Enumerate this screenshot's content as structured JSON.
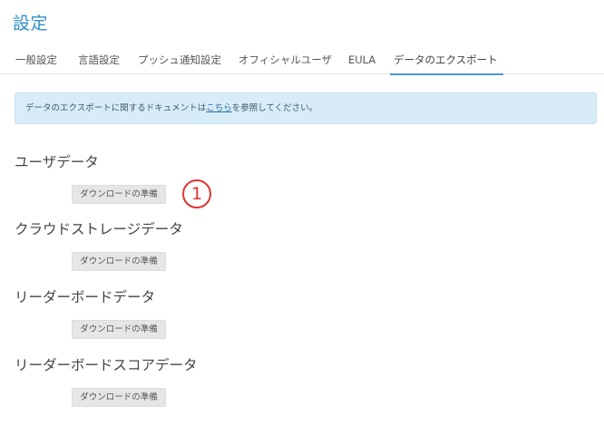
{
  "header": {
    "title": "設定"
  },
  "tabs": [
    {
      "label": "一般設定"
    },
    {
      "label": "言語設定"
    },
    {
      "label": "プッシュ通知設定"
    },
    {
      "label": "オフィシャルユーザ"
    },
    {
      "label": "EULA"
    },
    {
      "label": "データのエクスポート",
      "active": true
    }
  ],
  "info": {
    "prefix": "データのエクスポートに関するドキュメントは",
    "link_text": "こちら",
    "suffix": "を参照してください。"
  },
  "sections": [
    {
      "heading": "ユーザデータ",
      "button_label": "ダウンロードの準備"
    },
    {
      "heading": "クラウドストレージデータ",
      "button_label": "ダウンロードの準備"
    },
    {
      "heading": "リーダーボードデータ",
      "button_label": "ダウンロードの準備"
    },
    {
      "heading": "リーダーボードスコアデータ",
      "button_label": "ダウンロードの準備"
    }
  ],
  "annotation": {
    "label": "1"
  },
  "colors": {
    "title": "#2f8fc9",
    "tab_underline": "#4a98d0",
    "info_bg": "#d8ecf7",
    "annotation": "#e03333"
  }
}
